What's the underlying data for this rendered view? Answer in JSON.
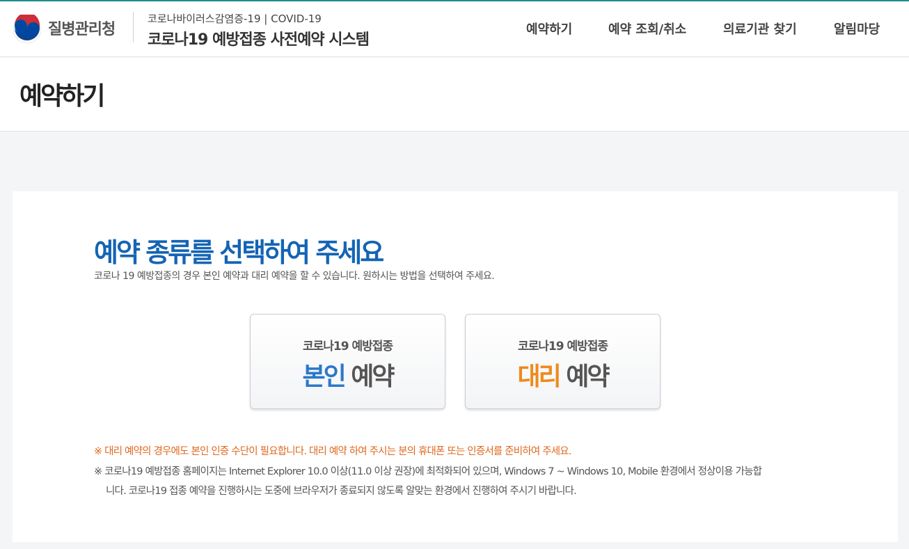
{
  "header": {
    "org_name": "질병관리청",
    "sub_title": "코로나바이러스감염증-19 | COVID-19",
    "system_title": "코로나19 예방접종 사전예약 시스템",
    "nav": [
      "예약하기",
      "예약 조회/취소",
      "의료기관 찾기",
      "알림마당"
    ]
  },
  "page": {
    "title": "예약하기"
  },
  "main": {
    "heading": "예약 종류를 선택하여 주세요",
    "description": "코로나 19 예방접종의 경우 본인 예약과 대리 예약을 할 수 있습니다. 원하시는 방법을 선택하여 주세요.",
    "self_option": {
      "top": "코로나19 예방접종",
      "emph": "본인",
      "rest": "예약"
    },
    "proxy_option": {
      "top": "코로나19 예방접종",
      "emph": "대리",
      "rest": "예약"
    },
    "notes": {
      "proxy_warning": "※ 대리 예약의 경우에도 본인 인증 수단이 필요합니다. 대리 예약 하여 주시는 분의 휴대폰 또는 인증서를 준비하여 주세요.",
      "browser_line1": "※ 코로나19 예방접종 홈페이지는 Internet Explorer 10.0 이상(11.0 이상 권장)에 최적화되어 있으며, Windows 7 ~ Windows 10, Mobile 환경에서 정상이용 가능합",
      "browser_line2": "니다. 코로나19 접종 예약을 진행하시는 도중에 브라우저가 종료되지 않도록 알맞는 환경에서 진행하여 주시기 바랍니다."
    }
  },
  "colors": {
    "heading_blue": "#1464b4",
    "self_blue": "#2c78c9",
    "proxy_orange": "#ee8a1c",
    "warning_orange": "#e0681e",
    "top_line": "#1b8d8d"
  },
  "icons": {
    "logo": "taegeuk-logo-icon"
  }
}
